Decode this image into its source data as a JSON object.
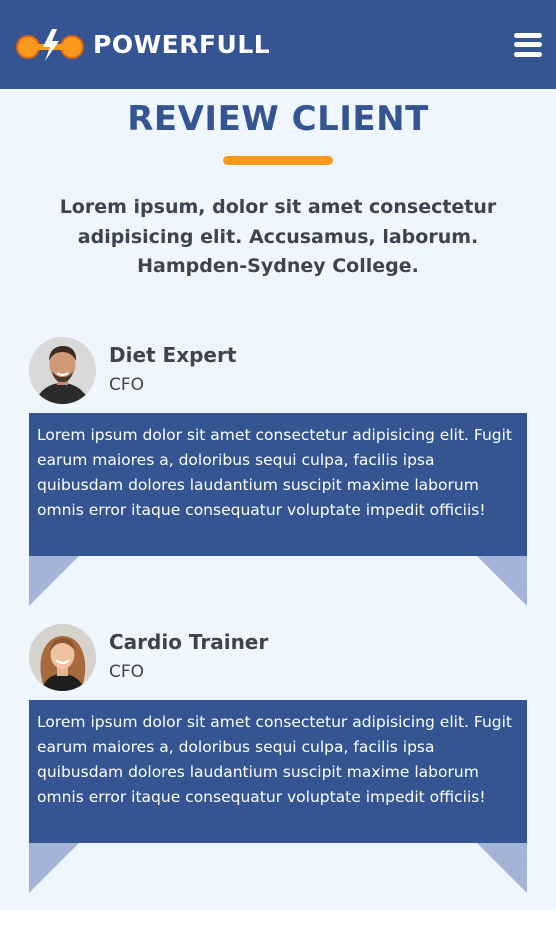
{
  "header": {
    "brand": "POWERFULL",
    "logo_icon": "dumbbell-lightning-logo",
    "menu_icon": "hamburger-menu-icon"
  },
  "section": {
    "title": "REVIEW CLIENT",
    "intro": "Lorem ipsum, dolor sit amet consectetur adipisicing elit. Accusamus, laborum. Hampden-Sydney College."
  },
  "reviews": [
    {
      "name": "Diet Expert",
      "role": "CFO",
      "quote": "Lorem ipsum dolor sit amet consectetur adipisicing elit. Fugit earum maiores a, doloribus sequi culpa, facilis ipsa quibusdam dolores laudantium suscipit maxime laborum omnis error itaque consequatur voluptate impedit officiis!"
    },
    {
      "name": "Cardio Trainer",
      "role": "CFO",
      "quote": "Lorem ipsum dolor sit amet consectetur adipisicing elit. Fugit earum maiores a, doloribus sequi culpa, facilis ipsa quibusdam dolores laudantium suscipit maxime laborum omnis error itaque consequatur voluptate impedit officiis!"
    }
  ],
  "colors": {
    "primary": "#345592",
    "accent": "#f7991d",
    "background": "#eff6fe",
    "tail": "#a3b4d7"
  }
}
